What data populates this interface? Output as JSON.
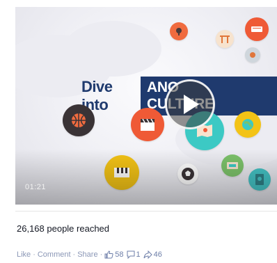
{
  "video": {
    "headline_lead": "Dive into",
    "headline_band_before": "ANO",
    "headline_band_after": "CULTURE",
    "duration": "01:21",
    "accent_color": "#1f3a6e",
    "bubbles": [
      {
        "name": "lamp-icon",
        "color": "#f06b3f"
      },
      {
        "name": "gate-icon",
        "color": "#f7e3ce"
      },
      {
        "name": "book-icon",
        "color": "#ef5a36"
      },
      {
        "name": "paint-icon",
        "color": "#cfd6dc"
      },
      {
        "name": "basketball-icon",
        "color": "#3a3336"
      },
      {
        "name": "clapperboard-icon",
        "color": "#ef5a36"
      },
      {
        "name": "map-icon",
        "color": "#3cc9c4"
      },
      {
        "name": "globe-icon",
        "color": "#f3c316"
      },
      {
        "name": "piano-icon",
        "color": "#f3c316"
      },
      {
        "name": "soccer-ball-icon",
        "color": "#ffffff"
      },
      {
        "name": "ticket-icon",
        "color": "#7cc26a"
      },
      {
        "name": "passport-icon",
        "color": "#43c2c4"
      }
    ]
  },
  "stats": {
    "reach_text": "26,168 people reached"
  },
  "actions": {
    "like": "Like",
    "comment": "Comment",
    "share": "Share",
    "separator": "·",
    "like_count": "58",
    "comment_count": "1",
    "share_count": "46"
  }
}
